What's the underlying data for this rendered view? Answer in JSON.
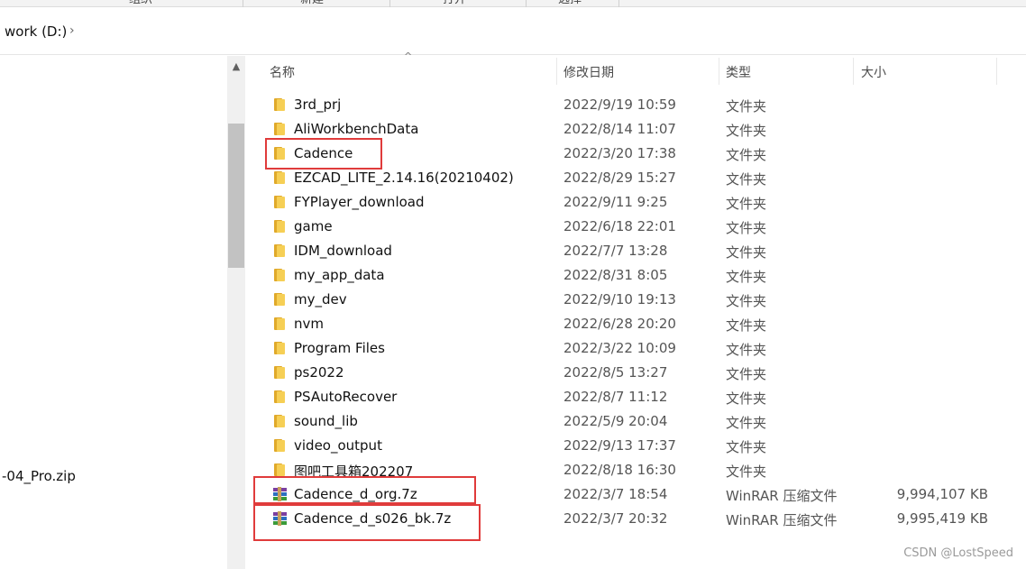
{
  "ribbon": {
    "groups": [
      "组织",
      "新建",
      "打开",
      "选择"
    ]
  },
  "address": {
    "path": "work (D:)",
    "chevron": "›"
  },
  "nav": {
    "items": [
      "-04_Pro.zip"
    ]
  },
  "scroll": {
    "up_glyph": "▲"
  },
  "columns": {
    "name": "名称",
    "date": "修改日期",
    "type": "类型",
    "size": "大小",
    "sort_glyph": "^"
  },
  "files": [
    {
      "name": "3rd_prj",
      "date": "2022/9/19 10:59",
      "type": "文件夹",
      "size": "",
      "icon": "folder-icon"
    },
    {
      "name": "AliWorkbenchData",
      "date": "2022/8/14 11:07",
      "type": "文件夹",
      "size": "",
      "icon": "folder-icon"
    },
    {
      "name": "Cadence",
      "date": "2022/3/20 17:38",
      "type": "文件夹",
      "size": "",
      "icon": "folder-icon"
    },
    {
      "name": "EZCAD_LITE_2.14.16(20210402)",
      "date": "2022/8/29 15:27",
      "type": "文件夹",
      "size": "",
      "icon": "folder-icon"
    },
    {
      "name": "FYPlayer_download",
      "date": "2022/9/11 9:25",
      "type": "文件夹",
      "size": "",
      "icon": "folder-icon"
    },
    {
      "name": "game",
      "date": "2022/6/18 22:01",
      "type": "文件夹",
      "size": "",
      "icon": "folder-icon"
    },
    {
      "name": "IDM_download",
      "date": "2022/7/7 13:28",
      "type": "文件夹",
      "size": "",
      "icon": "folder-icon"
    },
    {
      "name": "my_app_data",
      "date": "2022/8/31 8:05",
      "type": "文件夹",
      "size": "",
      "icon": "folder-icon"
    },
    {
      "name": "my_dev",
      "date": "2022/9/10 19:13",
      "type": "文件夹",
      "size": "",
      "icon": "folder-icon"
    },
    {
      "name": "nvm",
      "date": "2022/6/28 20:20",
      "type": "文件夹",
      "size": "",
      "icon": "folder-icon"
    },
    {
      "name": "Program Files",
      "date": "2022/3/22 10:09",
      "type": "文件夹",
      "size": "",
      "icon": "folder-icon"
    },
    {
      "name": "ps2022",
      "date": "2022/8/5 13:27",
      "type": "文件夹",
      "size": "",
      "icon": "folder-icon"
    },
    {
      "name": "PSAutoRecover",
      "date": "2022/8/7 11:12",
      "type": "文件夹",
      "size": "",
      "icon": "folder-icon"
    },
    {
      "name": "sound_lib",
      "date": "2022/5/9 20:04",
      "type": "文件夹",
      "size": "",
      "icon": "folder-icon"
    },
    {
      "name": "video_output",
      "date": "2022/9/13 17:37",
      "type": "文件夹",
      "size": "",
      "icon": "folder-icon"
    },
    {
      "name": "图吧工具箱202207",
      "date": "2022/8/18 16:30",
      "type": "文件夹",
      "size": "",
      "icon": "folder-icon"
    },
    {
      "name": "Cadence_d_org.7z",
      "date": "2022/3/7 18:54",
      "type": "WinRAR 压缩文件",
      "size": "9,994,107 KB",
      "icon": "winrar-archive-icon"
    },
    {
      "name": "Cadence_d_s026_bk.7z",
      "date": "2022/3/7 20:32",
      "type": "WinRAR 压缩文件",
      "size": "9,995,419 KB",
      "icon": "winrar-archive-icon"
    }
  ],
  "annotation": {
    "color": "#e03b3b"
  },
  "watermark": "CSDN @LostSpeed"
}
